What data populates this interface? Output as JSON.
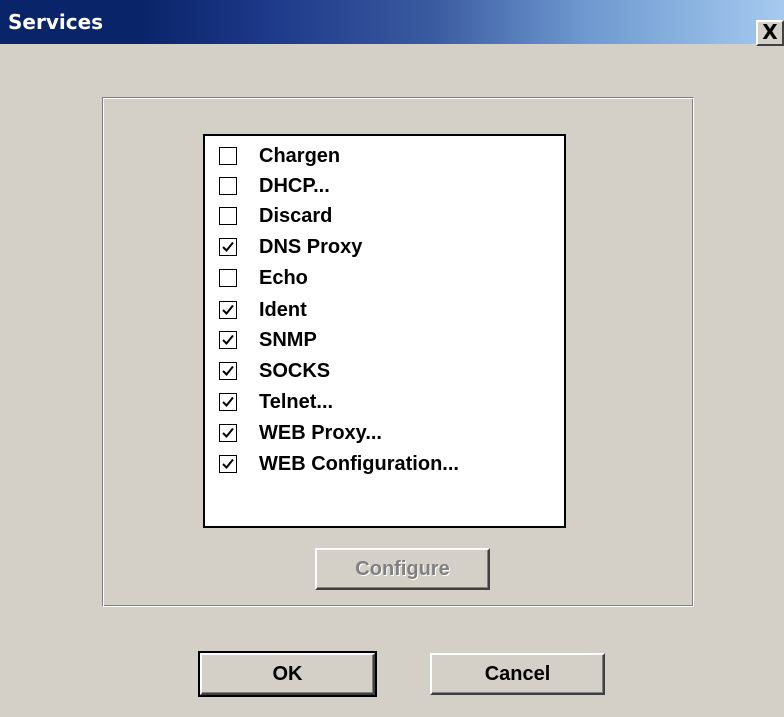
{
  "window": {
    "title": "Services",
    "close_label": "X"
  },
  "services": [
    {
      "label": "Chargen",
      "checked": false
    },
    {
      "label": "DHCP...",
      "checked": false
    },
    {
      "label": "Discard",
      "checked": false
    },
    {
      "label": "DNS Proxy",
      "checked": true
    },
    {
      "label": "Echo",
      "checked": false
    },
    {
      "label": "Ident",
      "checked": true
    },
    {
      "label": "SNMP",
      "checked": true
    },
    {
      "label": "SOCKS",
      "checked": true
    },
    {
      "label": "Telnet...",
      "checked": true
    },
    {
      "label": "WEB Proxy...",
      "checked": true
    },
    {
      "label": "WEB Configuration...",
      "checked": true
    }
  ],
  "buttons": {
    "configure": "Configure",
    "ok": "OK",
    "cancel": "Cancel"
  }
}
